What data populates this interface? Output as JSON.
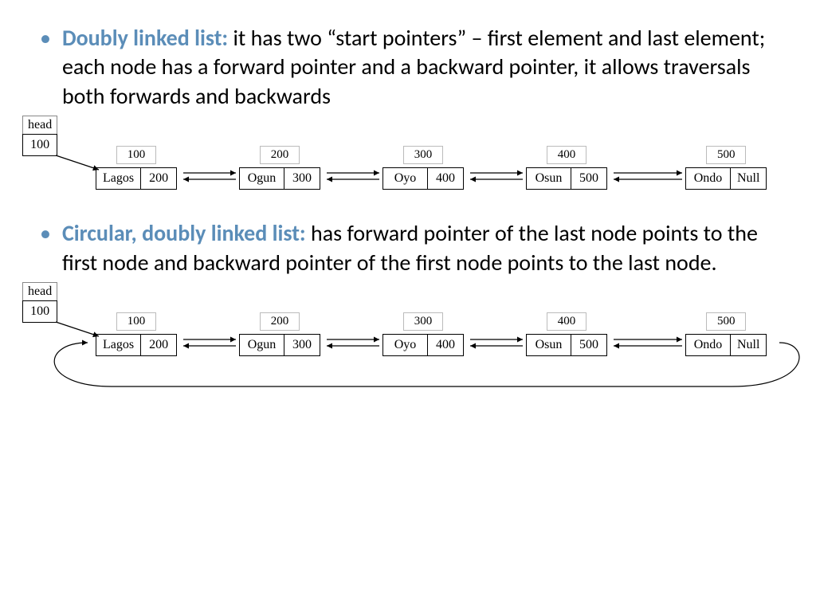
{
  "bullets": [
    {
      "term": "Doubly linked list:",
      "body": " it has two “start pointers” – first element and last element; each node has a forward pointer and a backward pointer, it allows traversals both forwards and backwards"
    },
    {
      "term": "Circular, doubly linked list:",
      "body": " has forward pointer of the last node points to the first node and backward pointer of the first node points to the last node."
    }
  ],
  "diagrams": [
    {
      "head": {
        "label": "head",
        "value": "100"
      },
      "nodes": [
        {
          "addr": "100",
          "data": "Lagos",
          "next": "200"
        },
        {
          "addr": "200",
          "data": "Ogun",
          "next": "300"
        },
        {
          "addr": "300",
          "data": "Oyo",
          "next": "400"
        },
        {
          "addr": "400",
          "data": "Osun",
          "next": "500"
        },
        {
          "addr": "500",
          "data": "Ondo",
          "next": "Null"
        }
      ],
      "circular": false
    },
    {
      "head": {
        "label": "head",
        "value": "100"
      },
      "nodes": [
        {
          "addr": "100",
          "data": "Lagos",
          "next": "200"
        },
        {
          "addr": "200",
          "data": "Ogun",
          "next": "300"
        },
        {
          "addr": "300",
          "data": "Oyo",
          "next": "400"
        },
        {
          "addr": "400",
          "data": "Osun",
          "next": "500"
        },
        {
          "addr": "500",
          "data": "Ondo",
          "next": "Null"
        }
      ],
      "circular": true
    }
  ],
  "chart_data": {
    "type": "table",
    "title": "Linked list diagrams",
    "lists": [
      {
        "kind": "doubly-linked",
        "head": 100,
        "nodes": [
          {
            "addr": 100,
            "data": "Lagos",
            "next": 200
          },
          {
            "addr": 200,
            "data": "Ogun",
            "next": 300
          },
          {
            "addr": 300,
            "data": "Oyo",
            "next": 400
          },
          {
            "addr": 400,
            "data": "Osun",
            "next": 500
          },
          {
            "addr": 500,
            "data": "Ondo",
            "next": null
          }
        ]
      },
      {
        "kind": "circular-doubly-linked",
        "head": 100,
        "nodes": [
          {
            "addr": 100,
            "data": "Lagos",
            "next": 200
          },
          {
            "addr": 200,
            "data": "Ogun",
            "next": 300
          },
          {
            "addr": 300,
            "data": "Oyo",
            "next": 400
          },
          {
            "addr": 400,
            "data": "Osun",
            "next": 500
          },
          {
            "addr": 500,
            "data": "Ondo",
            "next": null
          }
        ]
      }
    ]
  }
}
